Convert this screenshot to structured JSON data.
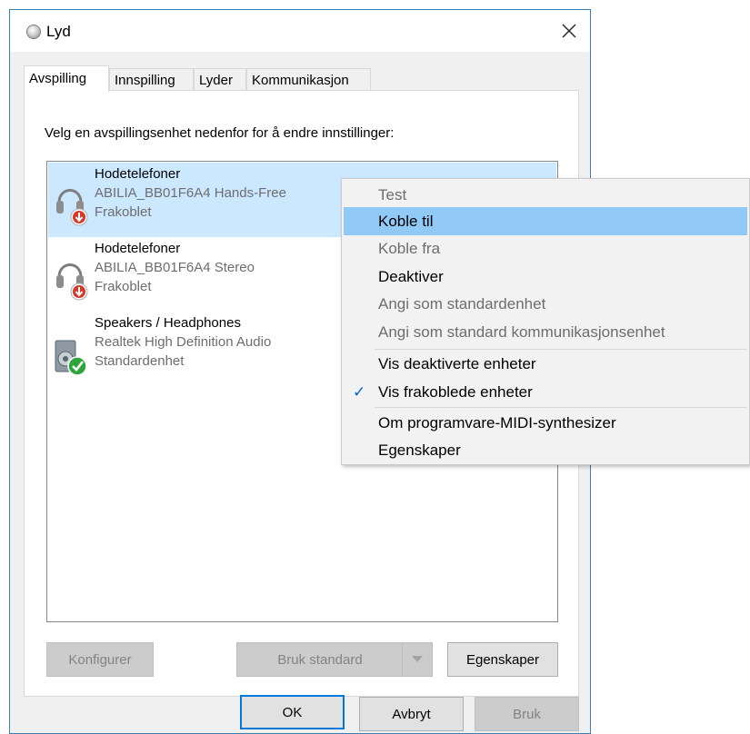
{
  "window": {
    "title": "Lyd",
    "close_icon": "close-icon"
  },
  "tabs": [
    {
      "label": "Avspilling",
      "active": true
    },
    {
      "label": "Innspilling",
      "active": false
    },
    {
      "label": "Lyder",
      "active": false
    },
    {
      "label": "Kommunikasjon",
      "active": false
    }
  ],
  "instruction": "Velg en avspillingsenhet nedenfor for å endre innstillinger:",
  "devices": [
    {
      "name": "Hodetelefoner",
      "description": "ABILIA_BB01F6A4 Hands-Free",
      "status": "Frakoblet",
      "icon": "headphones-icon",
      "badge": "disconnected-badge-icon",
      "selected": true
    },
    {
      "name": "Hodetelefoner",
      "description": "ABILIA_BB01F6A4 Stereo",
      "status": "Frakoblet",
      "icon": "headphones-icon",
      "badge": "disconnected-badge-icon",
      "selected": false
    },
    {
      "name": "Speakers / Headphones",
      "description": "Realtek High Definition Audio",
      "status": "Standardenhet",
      "icon": "speaker-icon",
      "badge": "default-check-badge-icon",
      "selected": false
    }
  ],
  "buttons": {
    "configure": "Konfigurer",
    "set_default": "Bruk standard",
    "properties": "Egenskaper",
    "ok": "OK",
    "cancel": "Avbryt",
    "apply": "Bruk"
  },
  "context_menu": {
    "items": [
      {
        "label": "Test",
        "enabled": false
      },
      {
        "label": "Koble til",
        "enabled": true,
        "highlighted": true
      },
      {
        "label": "Koble fra",
        "enabled": false
      },
      {
        "label": "Deaktiver",
        "enabled": true
      },
      {
        "label": "Angi som standardenhet",
        "enabled": false
      },
      {
        "label": "Angi som standard kommunikasjonsenhet",
        "enabled": false
      },
      {
        "label": "Vis deaktiverte enheter",
        "enabled": true
      },
      {
        "label": "Vis frakoblede enheter",
        "enabled": true,
        "checked": true
      },
      {
        "label": "Om programvare-MIDI-synthesizer",
        "enabled": true
      },
      {
        "label": "Egenskaper",
        "enabled": true
      }
    ]
  },
  "colors": {
    "selection": "#cce8ff",
    "menu_highlight": "#91c9f7",
    "accent": "#0078d7"
  }
}
